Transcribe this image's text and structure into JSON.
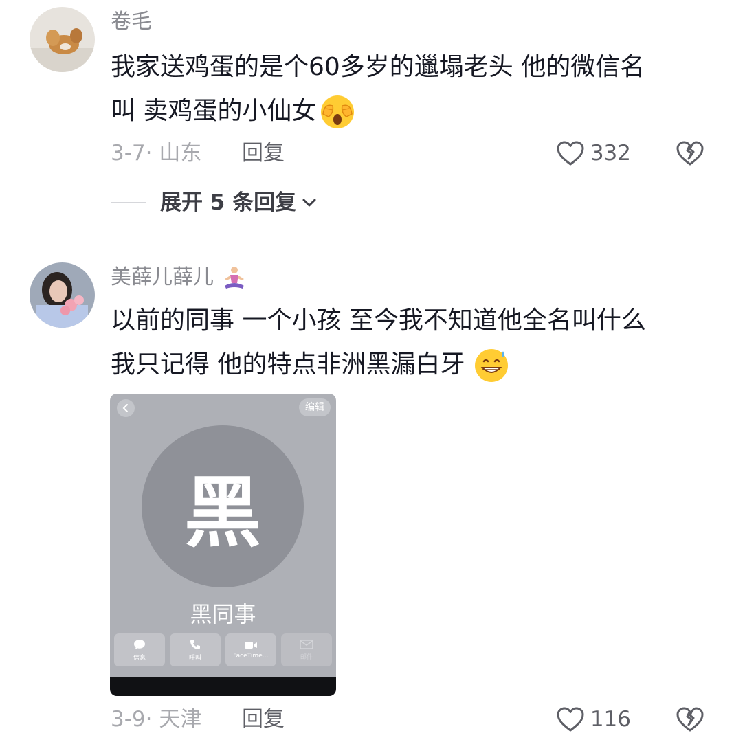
{
  "comments": [
    {
      "username": "卷毛",
      "text_line1": "我家送鸡蛋的是个60多岁的邋塌老头 他的微信名",
      "text_line2": "叫 卖鸡蛋的小仙女",
      "date_location": "3-7· 山东",
      "reply_label": "回复",
      "like_count": "332",
      "expand_label": "展开 5 条回复"
    },
    {
      "username": "美薛儿薛儿",
      "text_line1": "以前的同事 一个小孩 至今我不知道他全名叫什么",
      "text_line2": "我只记得 他的特点非洲黑漏白牙",
      "date_location": "3-9· 天津",
      "reply_label": "回复",
      "like_count": "116",
      "screenshot": {
        "edit_label": "编辑",
        "avatar_char": "黑",
        "contact_name": "黑同事",
        "actions": [
          "信息",
          "呼叫",
          "FaceTime…",
          "邮件"
        ]
      }
    }
  ]
}
